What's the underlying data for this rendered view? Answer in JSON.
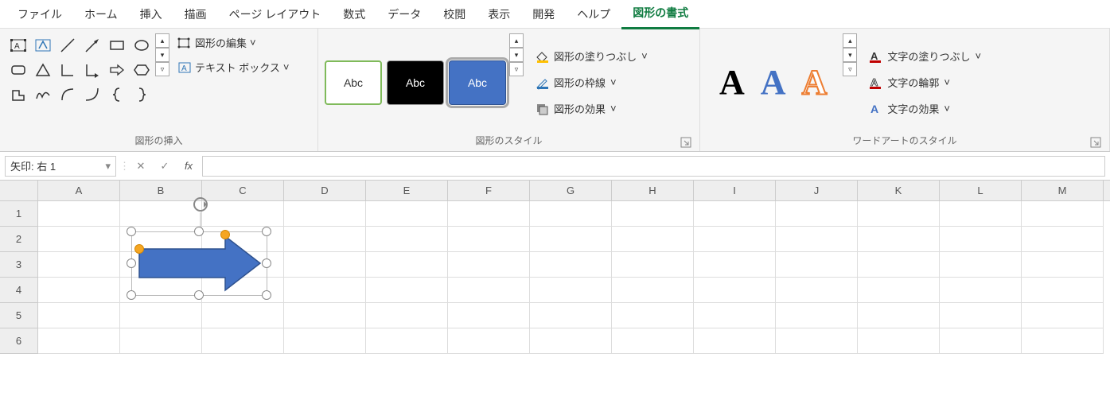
{
  "tabs": [
    "ファイル",
    "ホーム",
    "挿入",
    "描画",
    "ページ レイアウト",
    "数式",
    "データ",
    "校閲",
    "表示",
    "開発",
    "ヘルプ",
    "図形の書式"
  ],
  "active_tab": 11,
  "shape_insert": {
    "edit_shape": "図形の編集",
    "text_box": "テキスト ボックス",
    "group_label": "図形の挿入"
  },
  "shape_styles": {
    "sample": "Abc",
    "fill": "図形の塗りつぶし",
    "outline": "図形の枠線",
    "effects": "図形の効果",
    "group_label": "図形のスタイル"
  },
  "wordart": {
    "sample": "A",
    "fill": "文字の塗りつぶし",
    "outline": "文字の輪郭",
    "effects": "文字の効果",
    "group_label": "ワードアートのスタイル"
  },
  "namebox": "矢印: 右 1",
  "columns": [
    "A",
    "B",
    "C",
    "D",
    "E",
    "F",
    "G",
    "H",
    "I",
    "J",
    "K",
    "L",
    "M"
  ],
  "rows": [
    "1",
    "2",
    "3",
    "4",
    "5",
    "6"
  ],
  "shape": {
    "fill": "#4472C4",
    "stroke": "#2F528F"
  }
}
